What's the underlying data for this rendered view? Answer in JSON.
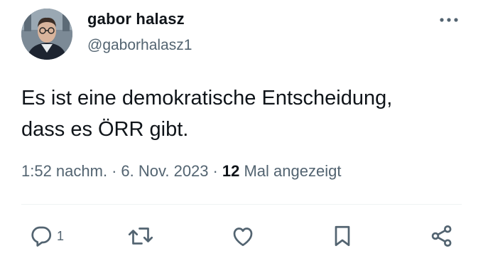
{
  "author": {
    "display_name": "gabor halasz",
    "handle": "@gaborhalasz1"
  },
  "tweet": {
    "lines": [
      "Es ist eine demokratische Entscheidung,",
      "dass es ÖRR gibt."
    ],
    "time": "1:52 nachm.",
    "date": "6. Nov. 2023",
    "separator": "·",
    "view_count": "12",
    "views_label": "Mal angezeigt"
  },
  "actions": {
    "reply_count": "1",
    "icons": [
      "reply-icon",
      "retweet-icon",
      "like-icon",
      "bookmark-icon",
      "share-icon"
    ]
  },
  "colors": {
    "primary_text": "#0f1419",
    "secondary_text": "#536471",
    "divider": "#eff3f4"
  }
}
